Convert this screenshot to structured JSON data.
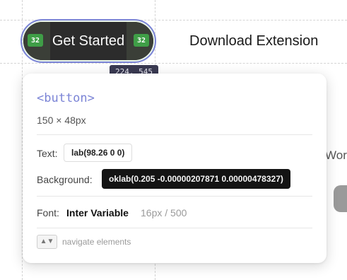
{
  "page": {
    "get_started_label": "Get Started",
    "left_badge": "32",
    "right_badge": "32",
    "download_label": "Download Extension",
    "coords": "224, 545",
    "partial_text": "Work"
  },
  "inspector": {
    "tag": "<button>",
    "dimensions": "150 × 48px",
    "text_label": "Text:",
    "text_value": "lab(98.26 0 0)",
    "background_label": "Background:",
    "background_value": "oklab(0.205 -0.00000207871 0.00000478327)",
    "font_label": "Font:",
    "font_family": "Inter Variable",
    "font_meta": "16px / 500",
    "nav_key": "▲▼",
    "nav_hint": "navigate elements"
  },
  "colors": {
    "accent": "#7b84d6",
    "badge_green": "#3f9e47",
    "button_bg": "#2c2c2c"
  }
}
